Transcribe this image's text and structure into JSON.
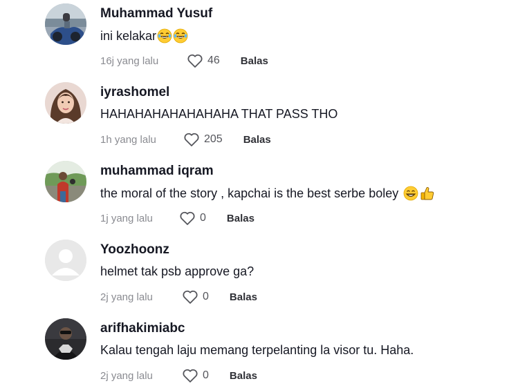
{
  "comments": [
    {
      "username": "Muhammad Yusuf",
      "text": "ini kelakar",
      "emojis": [
        "laughing-tears-emoji",
        "laughing-tears-emoji"
      ],
      "time": "16j yang lalu",
      "likes": "46",
      "reply_label": "Balas",
      "avatar": "photo-motorcycle"
    },
    {
      "username": "iyrashomel",
      "text": "HAHAHAHAHAHAHAHA THAT PASS THO",
      "emojis": [],
      "time": "1h yang lalu",
      "likes": "205",
      "reply_label": "Balas",
      "avatar": "photo-woman"
    },
    {
      "username": "muhammad iqram",
      "text": "the moral of the story , kapchai is the best serbe boley ",
      "emojis": [
        "grinning-emoji",
        "thumbs-up-emoji"
      ],
      "time": "1j yang lalu",
      "likes": "0",
      "reply_label": "Balas",
      "avatar": "photo-outdoor-man"
    },
    {
      "username": "Yoozhoonz",
      "text": "helmet tak psb approve ga?",
      "emojis": [],
      "time": "2j yang lalu",
      "likes": "0",
      "reply_label": "Balas",
      "avatar": "default-avatar"
    },
    {
      "username": "arifhakimiabc",
      "text": "Kalau tengah laju memang terpelanting la visor tu. Haha.",
      "emojis": [],
      "time": "2j yang lalu",
      "likes": "0",
      "reply_label": "Balas",
      "avatar": "photo-dark-man"
    }
  ],
  "colors": {
    "username": "#161823",
    "body_text": "#161823",
    "meta_text": "#8a8b91",
    "reply_text": "#2f3036",
    "heart_outline": "#54555b"
  }
}
